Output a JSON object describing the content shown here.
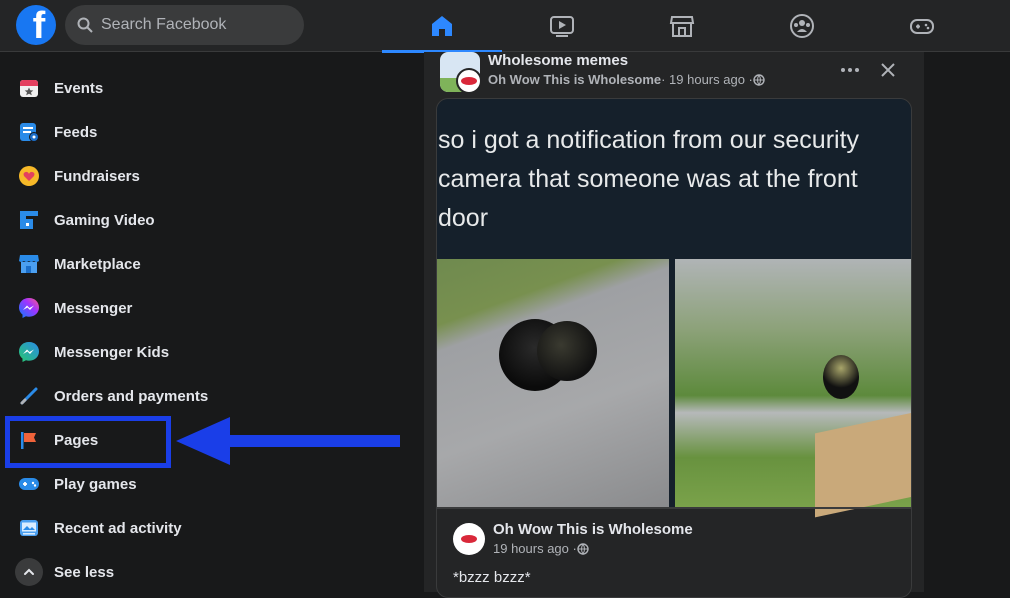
{
  "header": {
    "logo_letter": "f",
    "search_placeholder": "Search Facebook",
    "nav": [
      {
        "name": "home-icon",
        "active": true
      },
      {
        "name": "watch-icon",
        "active": false
      },
      {
        "name": "marketplace-icon",
        "active": false
      },
      {
        "name": "groups-icon",
        "active": false
      },
      {
        "name": "gaming-icon",
        "active": false
      }
    ]
  },
  "sidebar": {
    "items": [
      {
        "label": "Events",
        "icon": "calendar-icon"
      },
      {
        "label": "Feeds",
        "icon": "feeds-icon"
      },
      {
        "label": "Fundraisers",
        "icon": "heart-icon"
      },
      {
        "label": "Gaming Video",
        "icon": "gaming-video-icon"
      },
      {
        "label": "Marketplace",
        "icon": "shop-icon"
      },
      {
        "label": "Messenger",
        "icon": "messenger-icon"
      },
      {
        "label": "Messenger Kids",
        "icon": "messenger-kids-icon"
      },
      {
        "label": "Orders and payments",
        "icon": "pen-icon"
      },
      {
        "label": "Pages",
        "icon": "flag-icon"
      },
      {
        "label": "Play games",
        "icon": "gamepad-icon"
      },
      {
        "label": "Recent ad activity",
        "icon": "ad-icon"
      },
      {
        "label": "See less",
        "icon": "chevron-up-icon"
      }
    ],
    "highlight_color": "#1a3ee8"
  },
  "post": {
    "group_name": "Wholesome memes",
    "author": "Oh Wow This is Wholesome",
    "time": " · 19 hours ago · ",
    "meme_text": "so i got a notification from our security camera that someone was at the front door",
    "inner_author": "Oh Wow This is Wholesome",
    "inner_time": "19 hours ago · ",
    "inner_text": "*bzzz bzzz*"
  },
  "colors": {
    "accent": "#2d88ff",
    "background": "#18191a",
    "surface": "#242526"
  }
}
